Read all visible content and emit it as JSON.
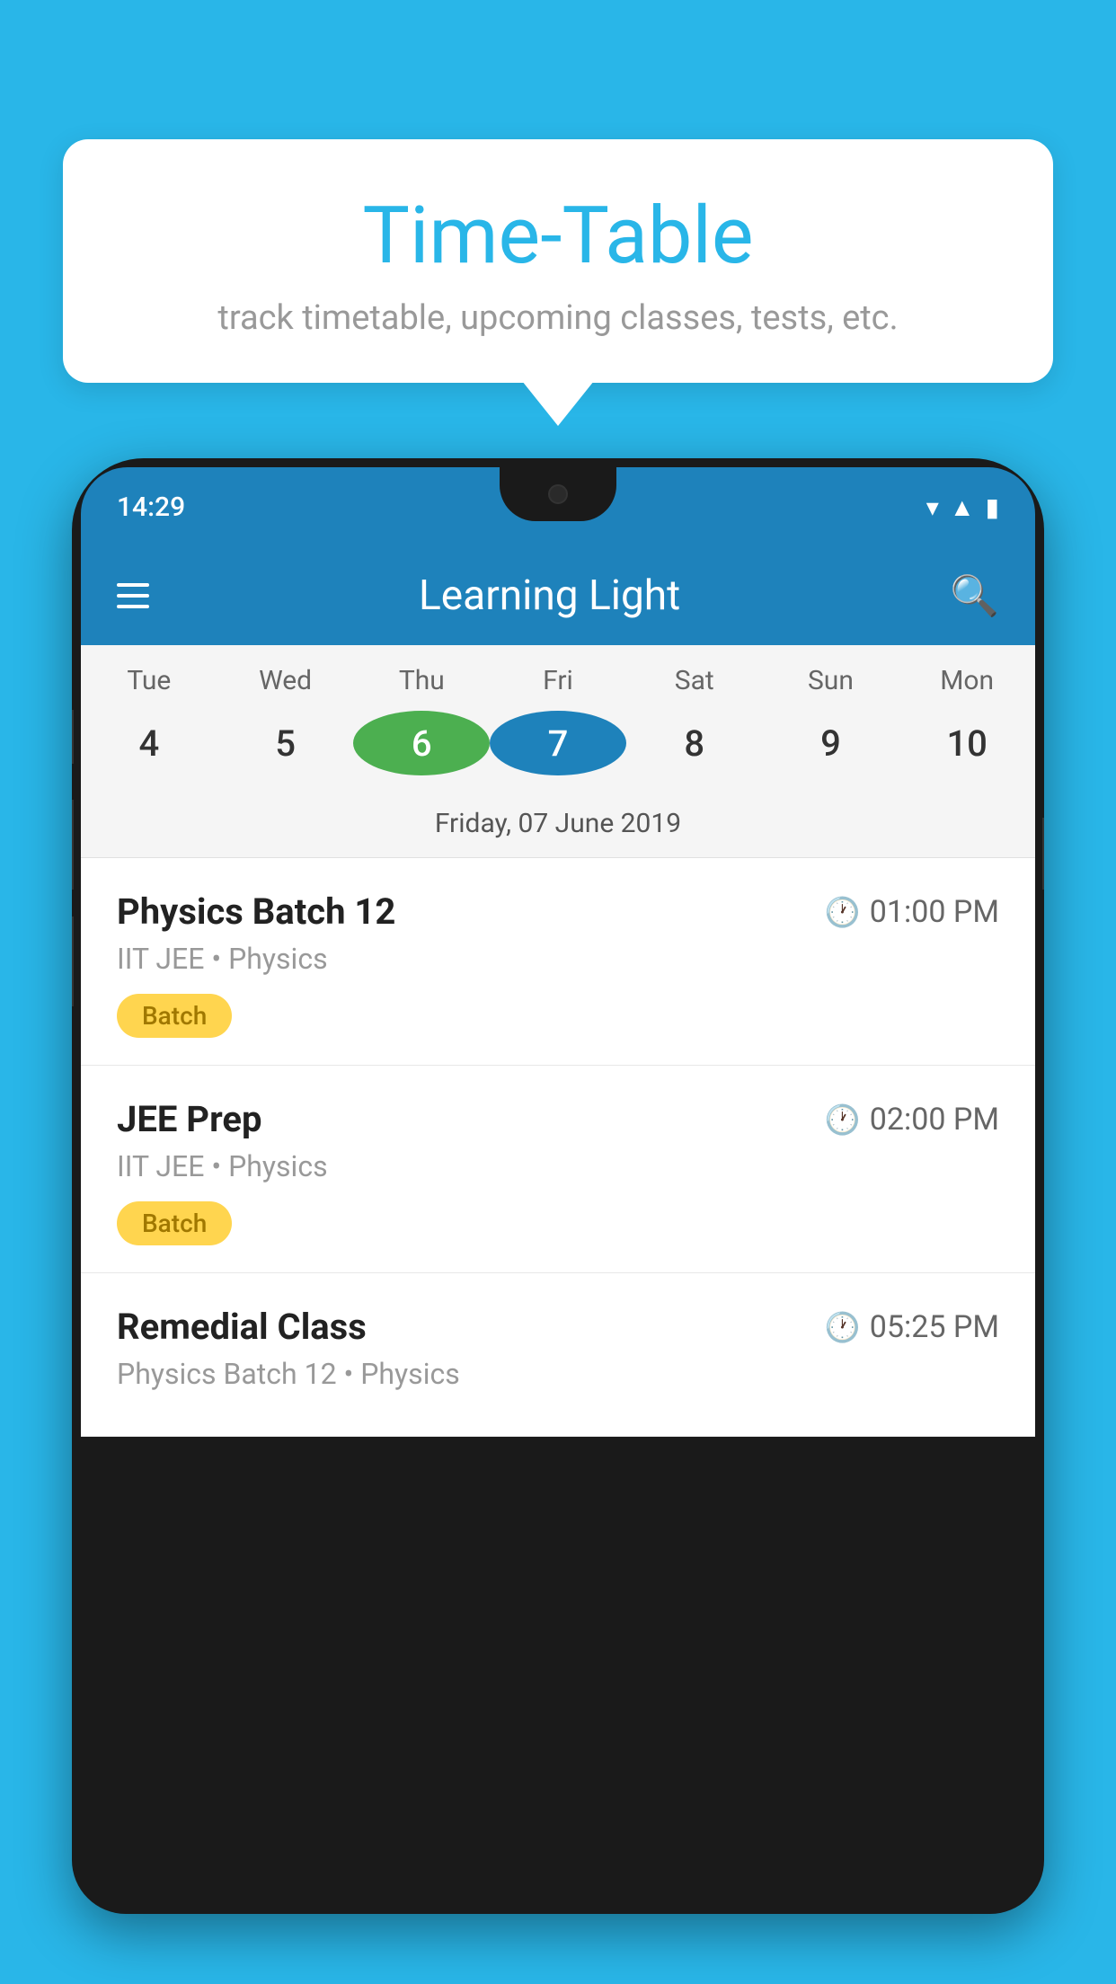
{
  "background_color": "#29b6e8",
  "tooltip": {
    "title": "Time-Table",
    "subtitle": "track timetable, upcoming classes, tests, etc."
  },
  "phone": {
    "status_bar": {
      "time": "14:29"
    },
    "app_bar": {
      "title": "Learning Light"
    },
    "calendar": {
      "days": [
        {
          "name": "Tue",
          "num": "4"
        },
        {
          "name": "Wed",
          "num": "5"
        },
        {
          "name": "Thu",
          "num": "6",
          "state": "today-green"
        },
        {
          "name": "Fri",
          "num": "7",
          "state": "selected-blue"
        },
        {
          "name": "Sat",
          "num": "8"
        },
        {
          "name": "Sun",
          "num": "9"
        },
        {
          "name": "Mon",
          "num": "10"
        }
      ],
      "selected_date_label": "Friday, 07 June 2019"
    },
    "schedule": [
      {
        "title": "Physics Batch 12",
        "time": "01:00 PM",
        "subtitle": "IIT JEE • Physics",
        "badge": "Batch"
      },
      {
        "title": "JEE Prep",
        "time": "02:00 PM",
        "subtitle": "IIT JEE • Physics",
        "badge": "Batch"
      },
      {
        "title": "Remedial Class",
        "time": "05:25 PM",
        "subtitle": "Physics Batch 12 • Physics",
        "badge": null
      }
    ]
  }
}
